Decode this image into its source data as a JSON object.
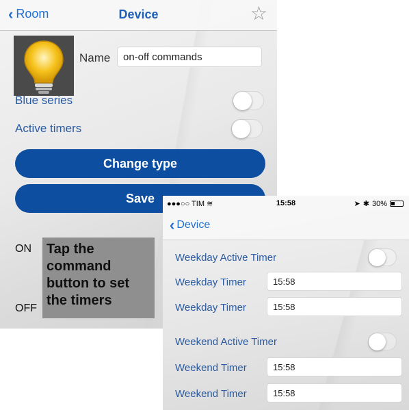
{
  "device_screen": {
    "nav": {
      "back_label": "Room",
      "title": "Device",
      "star_icon": "star-outline-icon"
    },
    "name_label": "Name",
    "name_value": "on-off commands",
    "blue_series_label": "Blue series",
    "active_timers_label": "Active timers",
    "change_type_label": "Change type",
    "save_label": "Save",
    "on_label": "ON",
    "off_label": "OFF",
    "callout_text": "Tap the command button to set the timers"
  },
  "timer_screen": {
    "status": {
      "carrier": "●●●○○ TIM",
      "wifi_icon": "wifi-icon",
      "time": "15:58",
      "battery": "30%"
    },
    "nav": {
      "back_label": "Device"
    },
    "weekday_active_label": "Weekday Active Timer",
    "rows": [
      {
        "label": "Weekday Timer",
        "value": "15:58"
      },
      {
        "label": "Weekday Timer",
        "value": "15:58"
      }
    ],
    "weekend_active_label": "Weekend Active Timer",
    "weekend_rows": [
      {
        "label": "Weekend Timer",
        "value": "15:58"
      },
      {
        "label": "Weekend Timer",
        "value": "15:58"
      }
    ]
  },
  "colors": {
    "accent": "#1f6fd6",
    "button": "#0d4ea0",
    "callout": "#8f8f8f",
    "bulb": "#f6c21b"
  }
}
